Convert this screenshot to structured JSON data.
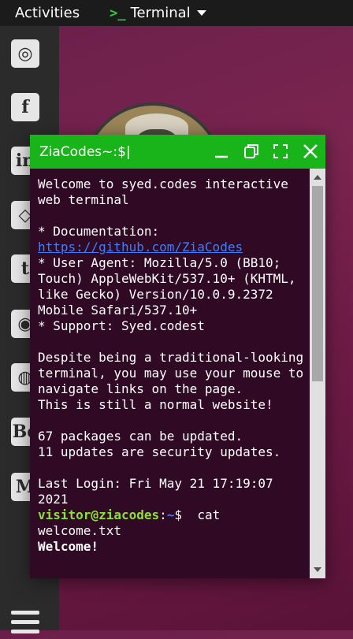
{
  "topbar": {
    "activities": "Activities",
    "app_icon": ">_",
    "app_name": "Terminal"
  },
  "dock": {
    "icons": [
      "instagram-icon",
      "facebook-icon",
      "linkedin-icon",
      "unity-icon",
      "twitter-icon",
      "github-icon",
      "dribbble-icon",
      "behance-icon",
      "medium-icon"
    ],
    "glyphs": [
      "◎",
      "f",
      "in",
      "◇",
      "t",
      "◉",
      "◍",
      "Be",
      "M"
    ]
  },
  "window": {
    "title": "ZiaCodes~:$|",
    "accent": "#19b31a",
    "background": "#300a24"
  },
  "terminal": {
    "welcome": "Welcome to syed.codes interactive web terminal",
    "doc_label": "* Documentation:",
    "doc_link": "https://github.com/ZiaCodes",
    "user_agent": "* User Agent: Mozilla/5.0 (BB10; Touch) AppleWebKit/537.10+ (KHTML, like Gecko) Version/10.0.9.2372 Mobile Safari/537.10+",
    "support": "* Support: Syed.codest",
    "desc1": "Despite being a traditional-looking terminal, you may use your mouse to navigate links on the page.",
    "desc2": "This is still a normal website!",
    "pkg1": "67 packages can be updated.",
    "pkg2": "11 updates are security updates.",
    "last_login": "Last Login: Fri May 21 17:19:07 2021",
    "prompt_user": "visitor@ziacodes",
    "prompt_colon": ":",
    "prompt_path": "~",
    "prompt_sign": "$",
    "command": "  cat welcome.txt",
    "output_partial": "Welcome!"
  }
}
